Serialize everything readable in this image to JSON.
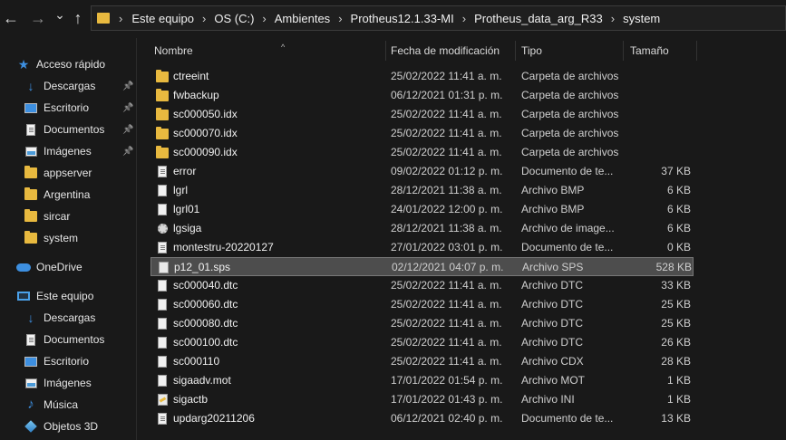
{
  "nav": {
    "back": "←",
    "forward": "→",
    "recent": "⌄",
    "up": "↑"
  },
  "breadcrumb": [
    "Este equipo",
    "OS (C:)",
    "Ambientes",
    "Protheus12.1.33-MI",
    "Protheus_data_arg_R33",
    "system"
  ],
  "breadcrumb_sep": "›",
  "sidebar": {
    "quick_access": "Acceso rápido",
    "quick_items": [
      {
        "label": "Descargas",
        "icon": "download-icon",
        "pinned": true
      },
      {
        "label": "Escritorio",
        "icon": "desktop-icon",
        "pinned": true
      },
      {
        "label": "Documentos",
        "icon": "documents-icon",
        "pinned": true
      },
      {
        "label": "Imágenes",
        "icon": "images-icon",
        "pinned": true
      },
      {
        "label": "appserver",
        "icon": "folder-icon",
        "pinned": false
      },
      {
        "label": "Argentina",
        "icon": "folder-icon",
        "pinned": false
      },
      {
        "label": "sircar",
        "icon": "folder-icon",
        "pinned": false
      },
      {
        "label": "system",
        "icon": "folder-icon",
        "pinned": false
      }
    ],
    "onedrive": "OneDrive",
    "this_pc": "Este equipo",
    "pc_items": [
      {
        "label": "Descargas",
        "icon": "download-icon"
      },
      {
        "label": "Documentos",
        "icon": "documents-icon"
      },
      {
        "label": "Escritorio",
        "icon": "desktop-icon"
      },
      {
        "label": "Imágenes",
        "icon": "images-icon"
      },
      {
        "label": "Música",
        "icon": "music-icon"
      },
      {
        "label": "Objetos 3D",
        "icon": "objects-3d-icon"
      }
    ],
    "pin_glyph": "📌"
  },
  "columns": {
    "name": "Nombre",
    "date": "Fecha de modificación",
    "type": "Tipo",
    "size": "Tamaño"
  },
  "files": [
    {
      "name": "ctreeint",
      "date": "25/02/2022 11:41 a. m.",
      "type": "Carpeta de archivos",
      "size": "",
      "icon": "folder-icon"
    },
    {
      "name": "fwbackup",
      "date": "06/12/2021 01:31 p. m.",
      "type": "Carpeta de archivos",
      "size": "",
      "icon": "folder-icon"
    },
    {
      "name": "sc000050.idx",
      "date": "25/02/2022 11:41 a. m.",
      "type": "Carpeta de archivos",
      "size": "",
      "icon": "folder-icon"
    },
    {
      "name": "sc000070.idx",
      "date": "25/02/2022 11:41 a. m.",
      "type": "Carpeta de archivos",
      "size": "",
      "icon": "folder-icon"
    },
    {
      "name": "sc000090.idx",
      "date": "25/02/2022 11:41 a. m.",
      "type": "Carpeta de archivos",
      "size": "",
      "icon": "folder-icon"
    },
    {
      "name": "error",
      "date": "09/02/2022 01:12 p. m.",
      "type": "Documento de te...",
      "size": "37 KB",
      "icon": "text-file-icon"
    },
    {
      "name": "lgrl",
      "date": "28/12/2021 11:38 a. m.",
      "type": "Archivo BMP",
      "size": "6 KB",
      "icon": "file-icon"
    },
    {
      "name": "lgrl01",
      "date": "24/01/2022 12:00 p. m.",
      "type": "Archivo BMP",
      "size": "6 KB",
      "icon": "file-icon"
    },
    {
      "name": "lgsiga",
      "date": "28/12/2021 11:38 a. m.",
      "type": "Archivo de image...",
      "size": "6 KB",
      "icon": "image-file-icon"
    },
    {
      "name": "montestru-20220127",
      "date": "27/01/2022 03:01 p. m.",
      "type": "Documento de te...",
      "size": "0 KB",
      "icon": "text-file-icon"
    },
    {
      "name": "p12_01.sps",
      "date": "02/12/2021 04:07 p. m.",
      "type": "Archivo SPS",
      "size": "528 KB",
      "icon": "sps-file-icon",
      "selected": true
    },
    {
      "name": "sc000040.dtc",
      "date": "25/02/2022 11:41 a. m.",
      "type": "Archivo DTC",
      "size": "33 KB",
      "icon": "file-icon"
    },
    {
      "name": "sc000060.dtc",
      "date": "25/02/2022 11:41 a. m.",
      "type": "Archivo DTC",
      "size": "25 KB",
      "icon": "file-icon"
    },
    {
      "name": "sc000080.dtc",
      "date": "25/02/2022 11:41 a. m.",
      "type": "Archivo DTC",
      "size": "25 KB",
      "icon": "file-icon"
    },
    {
      "name": "sc000100.dtc",
      "date": "25/02/2022 11:41 a. m.",
      "type": "Archivo DTC",
      "size": "26 KB",
      "icon": "file-icon"
    },
    {
      "name": "sc000110",
      "date": "25/02/2022 11:41 a. m.",
      "type": "Archivo CDX",
      "size": "28 KB",
      "icon": "file-icon"
    },
    {
      "name": "sigaadv.mot",
      "date": "17/01/2022 01:54 p. m.",
      "type": "Archivo MOT",
      "size": "1 KB",
      "icon": "file-icon"
    },
    {
      "name": "sigactb",
      "date": "17/01/2022 01:43 p. m.",
      "type": "Archivo INI",
      "size": "1 KB",
      "icon": "ini-file-icon"
    },
    {
      "name": "updarg20211206",
      "date": "06/12/2021 02:40 p. m.",
      "type": "Documento de te...",
      "size": "13 KB",
      "icon": "text-file-icon"
    }
  ]
}
